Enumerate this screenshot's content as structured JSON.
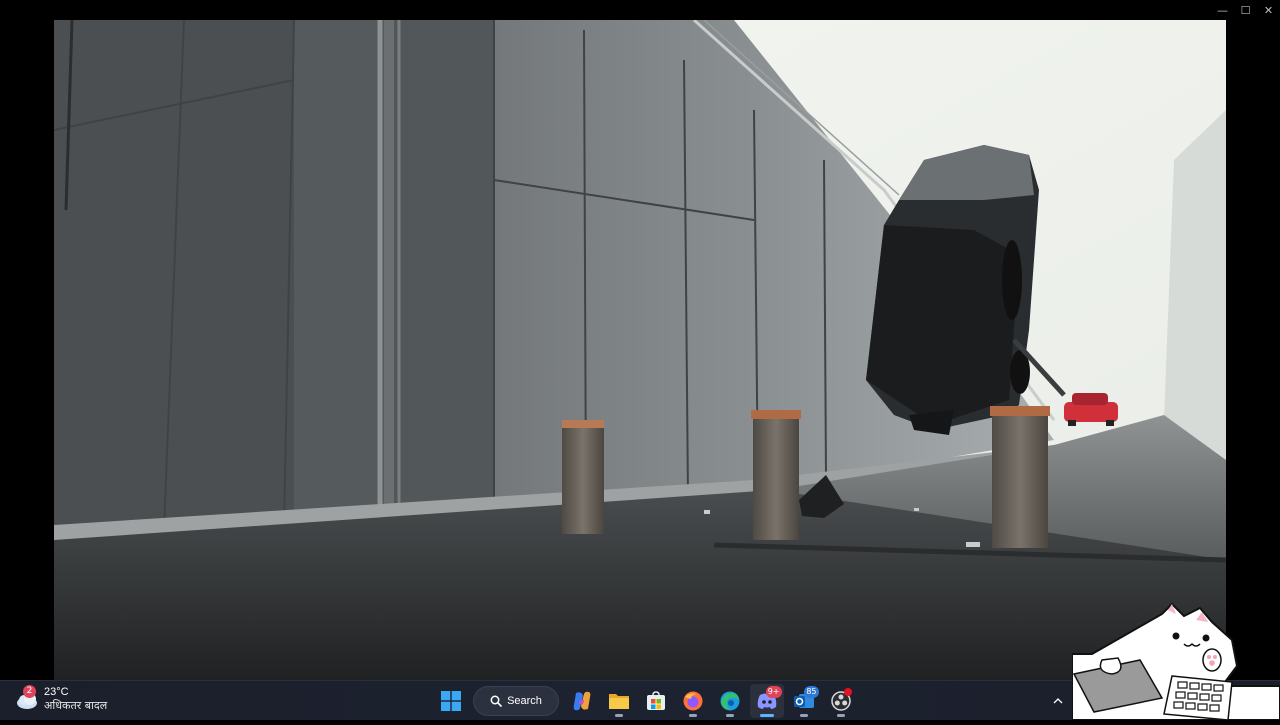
{
  "window": {
    "controls": [
      {
        "name": "minimize",
        "glyph": "—"
      },
      {
        "name": "maximize",
        "glyph": "☐"
      },
      {
        "name": "close",
        "glyph": "✕"
      }
    ]
  },
  "video": {
    "scene": "concrete-ramp-truck-crash"
  },
  "taskbar": {
    "weather": {
      "badge": "2",
      "temperature": "23°C",
      "condition": "अधिकतर बादल"
    },
    "search_label": "Search",
    "apps": [
      {
        "name": "start",
        "icon": "windows-logo-icon"
      },
      {
        "name": "copilot",
        "icon": "copilot-icon"
      },
      {
        "name": "file-explorer",
        "icon": "folder-icon"
      },
      {
        "name": "microsoft-store",
        "icon": "store-icon"
      },
      {
        "name": "firefox",
        "icon": "firefox-icon"
      },
      {
        "name": "edge",
        "icon": "edge-icon"
      },
      {
        "name": "discord",
        "icon": "discord-icon",
        "badge": "9+"
      },
      {
        "name": "outlook",
        "icon": "mail-icon",
        "badge": "85"
      },
      {
        "name": "obs",
        "icon": "obs-icon"
      }
    ],
    "colors": {
      "accent": "#5fb2ff",
      "badge_blue": "#2e78d8",
      "badge_red": "#e0445a"
    }
  },
  "overlay": {
    "name": "bongo-cat-overlay"
  }
}
